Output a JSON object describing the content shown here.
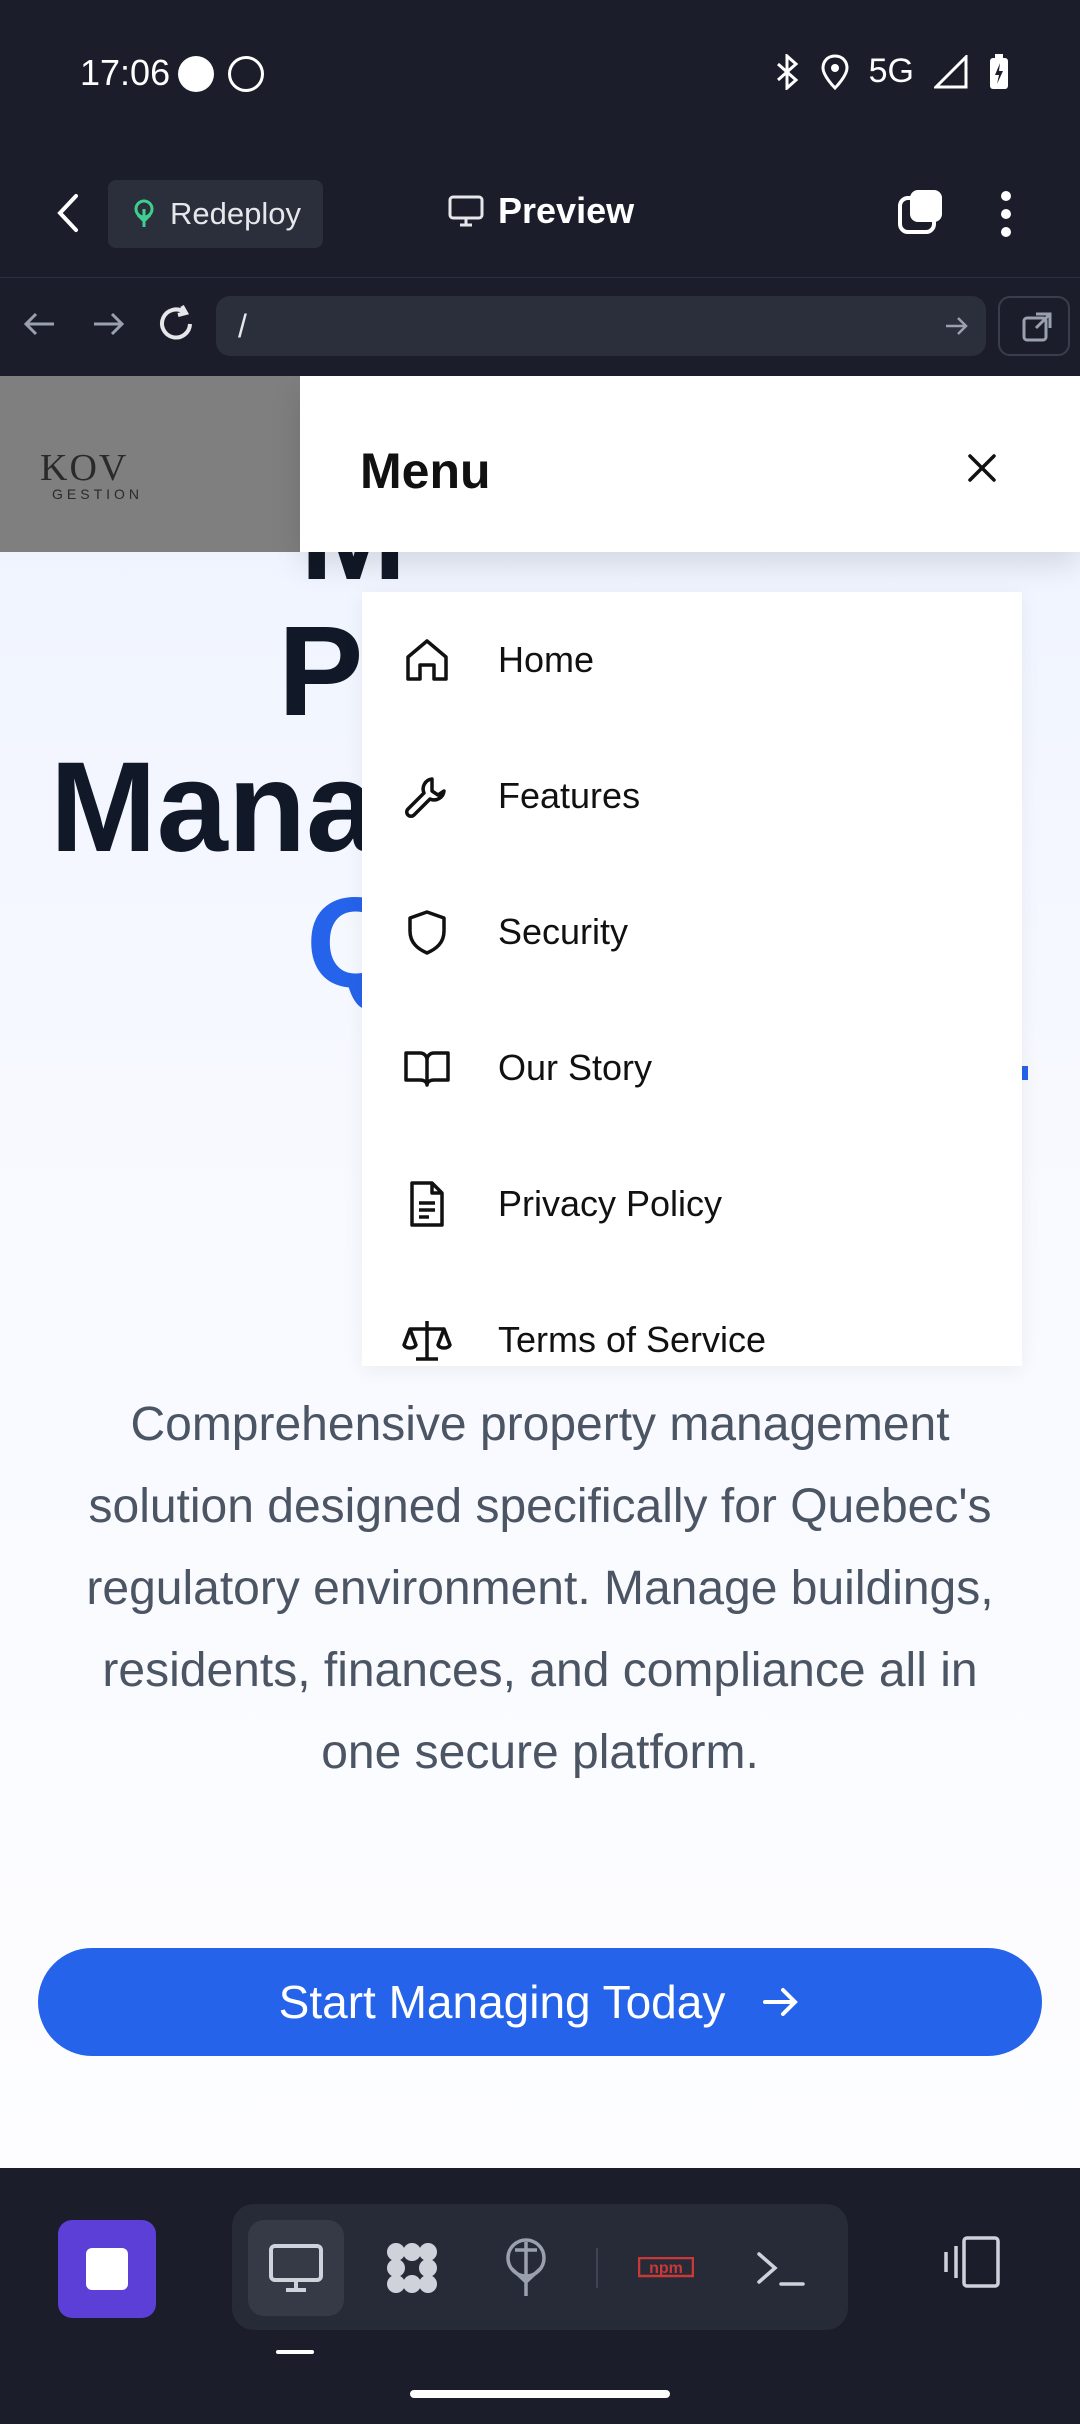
{
  "status_bar": {
    "time": "17:06",
    "left_icons": [
      "messenger-icon",
      "waze-icon"
    ],
    "right_icons": [
      "bluetooth-icon",
      "location-icon",
      "signal-icon",
      "battery-charging-icon"
    ],
    "network": "5G"
  },
  "app_header": {
    "back_icon": "chevron-left-icon",
    "redeploy_label": "Redeploy",
    "preview_label": "Preview",
    "tabs_icon": "tabs-icon",
    "more_icon": "more-vertical-icon"
  },
  "browser": {
    "url_path": "/",
    "back_icon": "arrow-left-icon",
    "forward_icon": "arrow-right-icon",
    "reload_icon": "reload-icon",
    "open_external_icon": "external-link-icon"
  },
  "site": {
    "logo_text": "KOV",
    "logo_subtext": "GESTION",
    "hero_lines": [
      "M",
      "P",
      "Mana",
      "Q"
    ],
    "description": "Comprehensive property management solution designed specifically for Quebec's regulatory environment. Manage buildings, residents, finances, and compliance all in one secure platform.",
    "cta_label": "Start Managing Today"
  },
  "menu": {
    "title": "Menu",
    "items": [
      {
        "label": "Home",
        "icon": "home-icon"
      },
      {
        "label": "Features",
        "icon": "wrench-icon"
      },
      {
        "label": "Security",
        "icon": "shield-icon"
      },
      {
        "label": "Our Story",
        "icon": "book-open-icon"
      },
      {
        "label": "Privacy Policy",
        "icon": "document-icon"
      },
      {
        "label": "Terms of Service",
        "icon": "scale-icon"
      }
    ]
  },
  "bottom_toolbar": {
    "tools": [
      "preview-tool-icon",
      "components-tool-icon",
      "deploy-tool-icon",
      "npm-tool-icon",
      "terminal-tool-icon"
    ],
    "npm_label": "npm",
    "accent_color": "#5b3fd6"
  },
  "colors": {
    "brand_blue": "#2563eb",
    "dark_bg": "#1b1e2a"
  }
}
